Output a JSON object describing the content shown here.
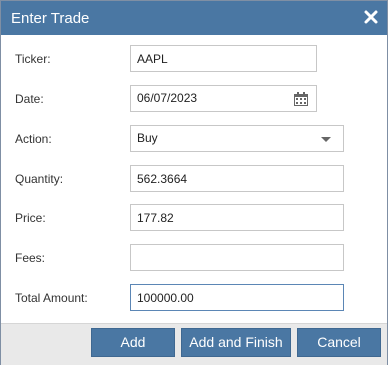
{
  "dialog": {
    "title": "Enter Trade"
  },
  "form": {
    "ticker": {
      "label": "Ticker:",
      "value": "AAPL"
    },
    "date": {
      "label": "Date:",
      "value": "06/07/2023"
    },
    "action": {
      "label": "Action:",
      "selected": "Buy"
    },
    "quantity": {
      "label": "Quantity:",
      "value": "562.3664"
    },
    "price": {
      "label": "Price:",
      "value": "177.82"
    },
    "fees": {
      "label": "Fees:",
      "value": ""
    },
    "total": {
      "label": "Total Amount:",
      "value": "100000.00"
    }
  },
  "buttons": {
    "add": "Add",
    "add_finish": "Add and Finish",
    "cancel": "Cancel"
  },
  "colors": {
    "accent": "#4a77a3",
    "footer_bg": "#e9e9e9",
    "focus_border": "#5b86b5"
  }
}
